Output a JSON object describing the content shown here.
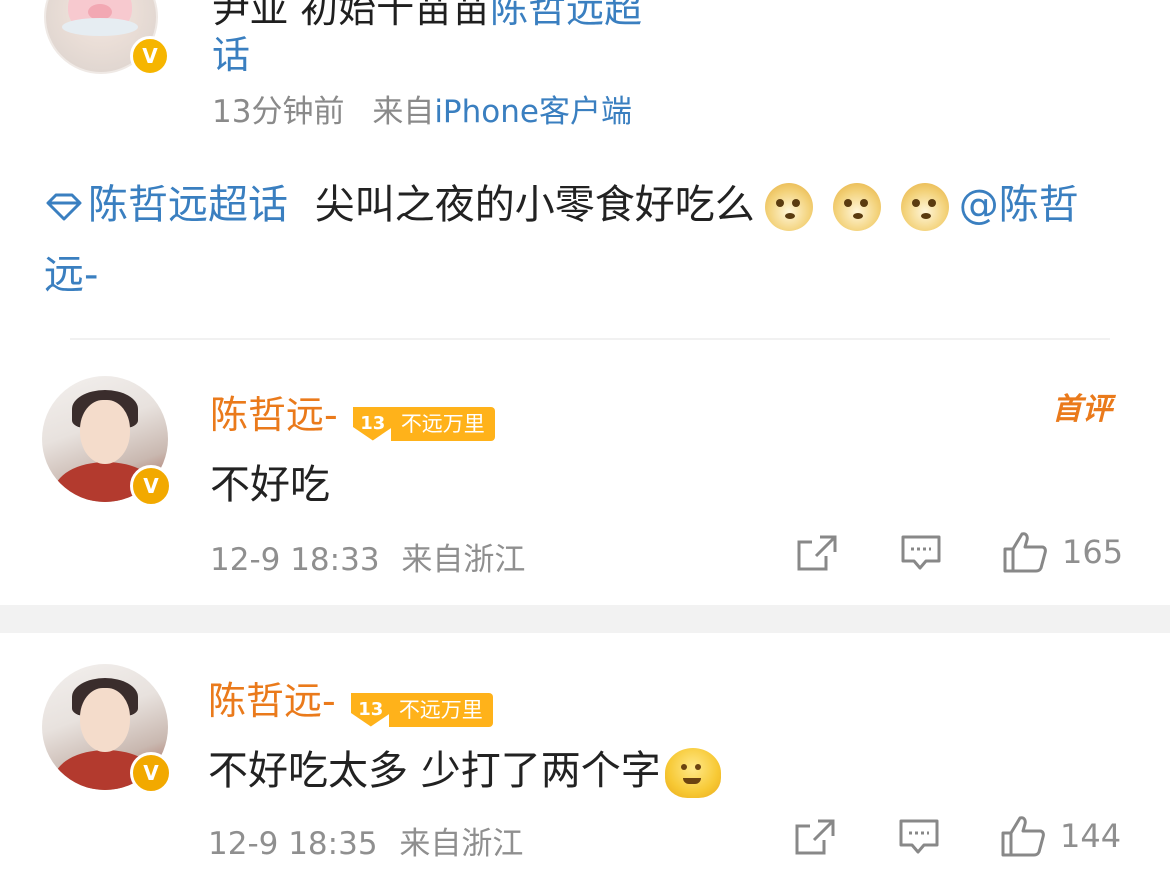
{
  "post": {
    "author_line_prefix": "尹亚 初始十苗苗",
    "author_line_topic": "陈哲远超",
    "author_line_cont": "话",
    "time": "13分钟前",
    "from_prefix": "来自",
    "source": "iPhone客户端",
    "topic_tag": "陈哲远超话",
    "text": "尖叫之夜的小零食好吃么",
    "emoji_names": [
      "doge-emoji",
      "doge-emoji",
      "doge-emoji"
    ],
    "mention": "@陈哲远-"
  },
  "comments": [
    {
      "name": "陈哲远-",
      "level": "13",
      "level_label": "不远万里",
      "first_tag": "首评",
      "text": "不好吃",
      "time": "12-9 18:33",
      "location": "来自浙江",
      "likes": "165",
      "emoji": ""
    },
    {
      "name": "陈哲远-",
      "level": "13",
      "level_label": "不远万里",
      "first_tag": "",
      "text": "不好吃太多 少打了两个字",
      "time": "12-9 18:35",
      "location": "来自浙江",
      "likes": "144",
      "emoji": "melting-face-emoji"
    }
  ],
  "verified_badge": "V",
  "colors": {
    "link_blue": "#3a7fc0",
    "name_orange": "#ea7a1b",
    "badge_gold": "#ffb21a",
    "meta_gray": "#8f8f8f"
  }
}
